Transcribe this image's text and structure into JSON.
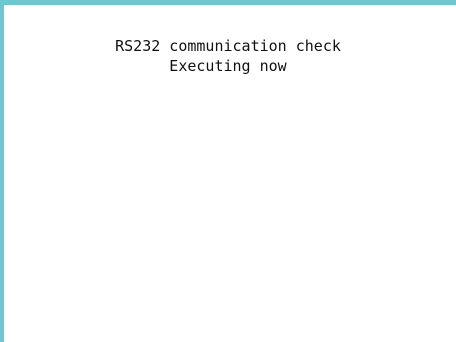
{
  "screen": {
    "frame_color": "#6fc6cf",
    "background_color": "#ffffff",
    "message": {
      "line1": "RS232 communication check",
      "line2": "Executing now"
    }
  }
}
